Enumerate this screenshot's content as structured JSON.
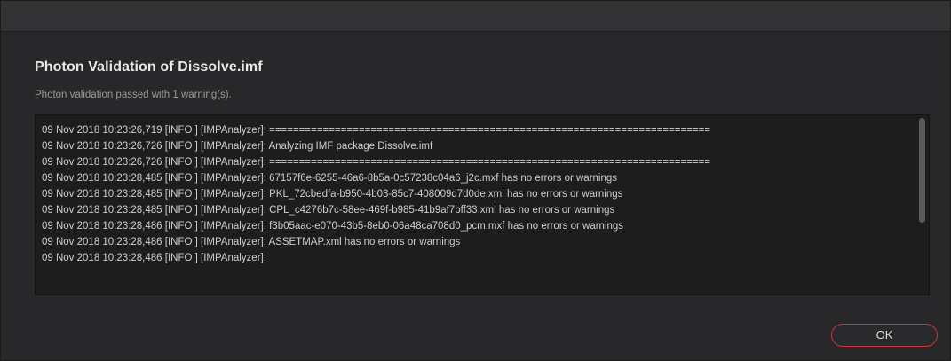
{
  "dialog": {
    "title": "Photon Validation of Dissolve.imf",
    "status": "Photon validation passed with 1 warning(s).",
    "ok_label": "OK"
  },
  "log": {
    "lines": [
      "09 Nov 2018 10:23:26,719 [INFO ] [IMPAnalyzer]: ==========================================================================",
      "09 Nov 2018 10:23:26,726 [INFO ] [IMPAnalyzer]: Analyzing IMF package Dissolve.imf",
      "09 Nov 2018 10:23:26,726 [INFO ] [IMPAnalyzer]: ==========================================================================",
      "09 Nov 2018 10:23:28,485 [INFO ] [IMPAnalyzer]: 67157f6e-6255-46a6-8b5a-0c57238c04a6_j2c.mxf has no errors or warnings",
      "09 Nov 2018 10:23:28,485 [INFO ] [IMPAnalyzer]: PKL_72cbedfa-b950-4b03-85c7-408009d7d0de.xml has no errors or warnings",
      "09 Nov 2018 10:23:28,485 [INFO ] [IMPAnalyzer]: CPL_c4276b7c-58ee-469f-b985-41b9af7bff33.xml has no errors or warnings",
      "09 Nov 2018 10:23:28,486 [INFO ] [IMPAnalyzer]: f3b05aac-e070-43b5-8eb0-06a48ca708d0_pcm.mxf has no errors or warnings",
      "09 Nov 2018 10:23:28,486 [INFO ] [IMPAnalyzer]: ASSETMAP.xml has no errors or warnings",
      "09 Nov 2018 10:23:28,486 [INFO ] [IMPAnalyzer]:"
    ]
  },
  "colors": {
    "background": "#28282a",
    "log_background": "#1d1d1e",
    "accent_border": "#c0383a"
  }
}
